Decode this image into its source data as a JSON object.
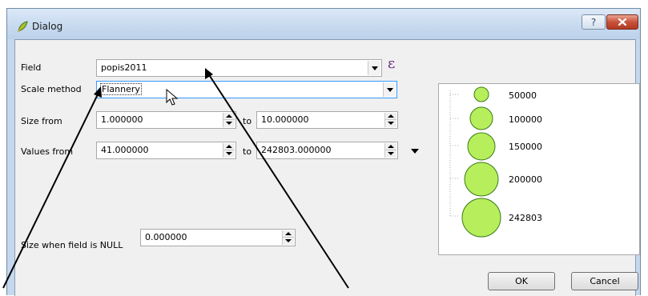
{
  "window": {
    "title": "Dialog",
    "help_label": "?",
    "close_label": "x"
  },
  "form": {
    "field_label": "Field",
    "field_value": "popis2011",
    "scale_method_label": "Scale method",
    "scale_method_value": "Flannery",
    "size_from_label": "Size from",
    "size_from_value": "1.000000",
    "size_to_label": "to",
    "size_to_value": "10.000000",
    "values_from_label": "Values from",
    "values_from_value": "41.000000",
    "values_to_label": "to",
    "values_to_value": "242803.000000",
    "null_label": "Size when field is NULL",
    "null_value": "0.000000",
    "expression_symbol": "ε"
  },
  "legend": {
    "fill_color": "#b7ef5c",
    "stroke_color": "#3a7a1a",
    "items": [
      {
        "label": "50000"
      },
      {
        "label": "100000"
      },
      {
        "label": "150000"
      },
      {
        "label": "200000"
      },
      {
        "label": "242803"
      }
    ]
  },
  "buttons": {
    "ok": "OK",
    "cancel": "Cancel"
  }
}
